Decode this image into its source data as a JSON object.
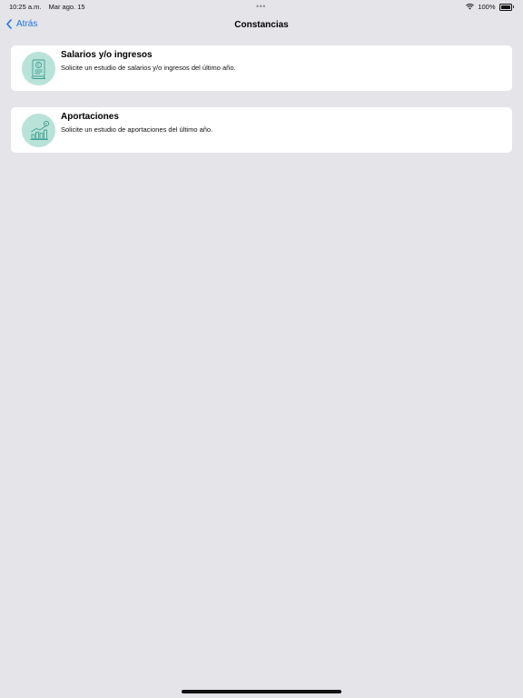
{
  "status_bar": {
    "time": "10:25 a.m.",
    "date": "Mar ago. 15",
    "dots": "•••",
    "battery": "100%"
  },
  "nav": {
    "back_label": "Atrás",
    "title": "Constancias"
  },
  "items": [
    {
      "title": "Salarios y/o ingresos",
      "subtitle": "Solicite un estudio de salarios y/o ingresos del último año.",
      "icon": "salary-document-icon"
    },
    {
      "title": "Aportaciones",
      "subtitle": "Solicite un estudio de aportaciones del último año.",
      "icon": "contributions-chart-icon"
    }
  ],
  "colors": {
    "background": "#e5e4e9",
    "accent": "#1a73e8",
    "icon_circle": "#b9e2d8",
    "icon_stroke": "#3f9f94"
  }
}
